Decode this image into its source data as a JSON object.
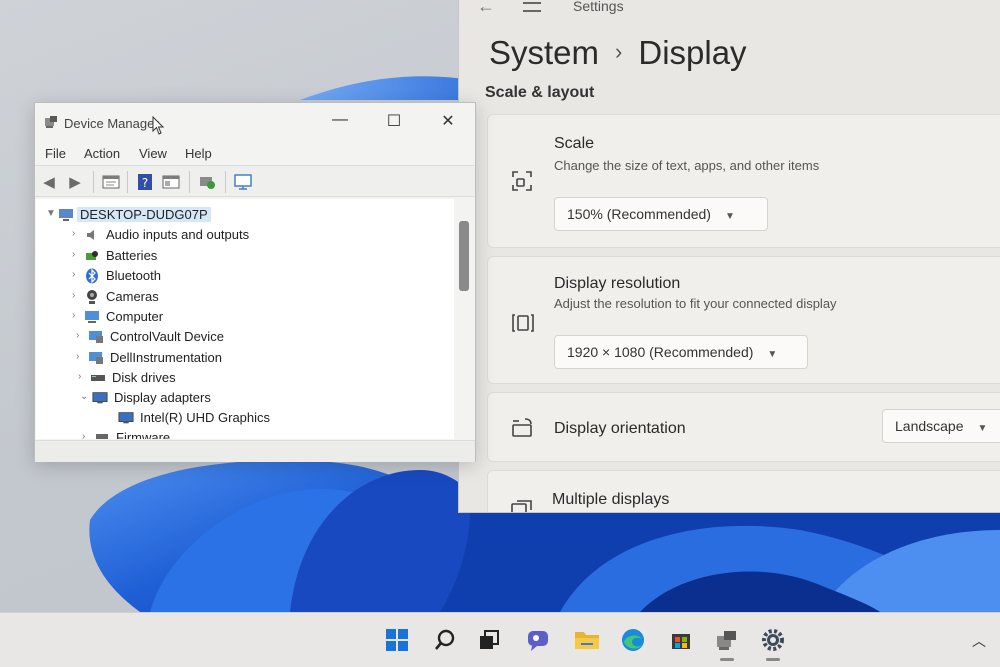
{
  "settings": {
    "app_title": "Settings",
    "breadcrumb": {
      "parent": "System",
      "separator": "›",
      "current": "Display"
    },
    "section_heading": "Scale & layout",
    "scale": {
      "title": "Scale",
      "subtitle": "Change the size of text, apps, and other items",
      "value": "150% (Recommended)"
    },
    "resolution": {
      "title": "Display resolution",
      "subtitle": "Adjust the resolution to fit your connected display",
      "value": "1920 × 1080 (Recommended)"
    },
    "orientation": {
      "title": "Display orientation",
      "value": "Landscape"
    },
    "multiple_displays": {
      "title": "Multiple displays"
    }
  },
  "device_manager": {
    "title": "Device Manager",
    "menu": [
      "File",
      "Action",
      "View",
      "Help"
    ],
    "root": "DESKTOP-DUDG07P",
    "tree": [
      {
        "label": "Audio inputs and outputs",
        "expanded": false,
        "icon": "speaker-icon"
      },
      {
        "label": "Batteries",
        "expanded": false,
        "icon": "battery-icon"
      },
      {
        "label": "Bluetooth",
        "expanded": false,
        "icon": "bluetooth-icon"
      },
      {
        "label": "Cameras",
        "expanded": false,
        "icon": "camera-icon"
      },
      {
        "label": "Computer",
        "expanded": false,
        "icon": "computer-icon"
      },
      {
        "label": "ControlVault Device",
        "expanded": false,
        "icon": "device-icon"
      },
      {
        "label": "DellInstrumentation",
        "expanded": false,
        "icon": "device-icon"
      },
      {
        "label": "Disk drives",
        "expanded": false,
        "icon": "disk-icon"
      },
      {
        "label": "Display adapters",
        "expanded": true,
        "icon": "monitor-icon"
      },
      {
        "label": "Intel(R) UHD Graphics",
        "child": true,
        "icon": "monitor-icon"
      },
      {
        "label": "Firmware",
        "expanded": false,
        "icon": "chip-icon"
      }
    ]
  },
  "taskbar": {
    "apps": [
      "start-icon",
      "search-icon",
      "task-view-icon",
      "chat-icon",
      "file-explorer-icon",
      "edge-icon",
      "store-icon",
      "device-manager-icon",
      "settings-icon"
    ]
  },
  "colors": {
    "wallpaper_blue": "#1f5fd6",
    "selection": "#d6e8f7",
    "settings_bg": "#e9e7e4"
  }
}
